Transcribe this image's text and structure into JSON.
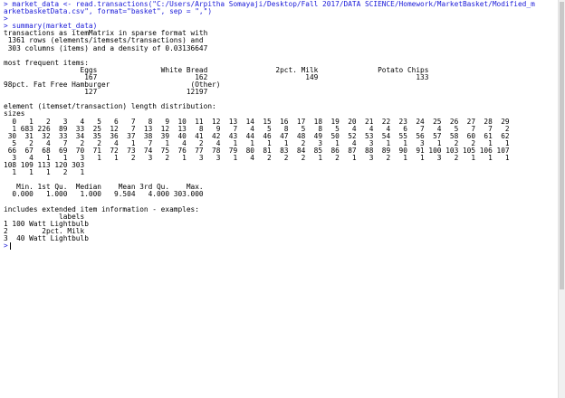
{
  "console": {
    "lines": [
      {
        "type": "cmd",
        "text": "> market_data <- read.transactions(\"C:/Users/Arpitha Somayaji/Desktop/Fall 2017/DATA SCIENCE/Homework/MarketBasket/Modified_m"
      },
      {
        "type": "cmd",
        "text": "arketbasketData.csv\", format=\"basket\", sep = \",\")"
      },
      {
        "type": "cmd",
        "text": ">"
      },
      {
        "type": "cmd",
        "text": "> summary(market_data)"
      },
      {
        "type": "out",
        "text": "transactions as itemMatrix in sparse format with"
      },
      {
        "type": "out",
        "text": " 1361 rows (elements/itemsets/transactions) and"
      },
      {
        "type": "out",
        "text": " 303 columns (items) and a density of 0.03136647"
      },
      {
        "type": "out",
        "text": ""
      },
      {
        "type": "out",
        "text": "most frequent items:"
      },
      {
        "type": "out",
        "text": "                  Eggs               White Bread                2pct. Milk              Potato Chips"
      },
      {
        "type": "out",
        "text": "                   167                       162                       149                       133"
      },
      {
        "type": "out",
        "text": "98pct. Fat Free Hamburger                   (Other)"
      },
      {
        "type": "out",
        "text": "                   127                     12197"
      },
      {
        "type": "out",
        "text": ""
      },
      {
        "type": "out",
        "text": "element (itemset/transaction) length distribution:"
      },
      {
        "type": "out",
        "text": "sizes"
      },
      {
        "type": "out",
        "text": "  0   1   2   3   4   5   6   7   8   9  10  11  12  13  14  15  16  17  18  19  20  21  22  23  24  25  26  27  28  29"
      },
      {
        "type": "out",
        "text": "  1 683 226  89  33  25  12   7  13  12  13   8   9   7   4   5   8   5   8   5   4   4   4   6   7   4   5   7   7   2"
      },
      {
        "type": "out",
        "text": " 30  31  32  33  34  35  36  37  38  39  40  41  42  43  44  46  47  48  49  50  52  53  54  55  56  57  58  60  61  62"
      },
      {
        "type": "out",
        "text": "  5   2   4   7   2   2   4   1   7   1   4   2   4   1   1   1   1   2   3   1   4   3   1   1   3   1   2   2   1   1"
      },
      {
        "type": "out",
        "text": " 66  67  68  69  70  71  72  73  74  75  76  77  78  79  80  81  83  84  85  86  87  88  89  90  91 100 103 105 106 107"
      },
      {
        "type": "out",
        "text": "  3   4   1   1   3   1   1   2   3   2   1   3   3   1   4   2   2   2   1   2   1   3   2   1   1   3   2   1   1   1"
      },
      {
        "type": "out",
        "text": "108 109 113 120 303"
      },
      {
        "type": "out",
        "text": "  1   1   1   2   1"
      },
      {
        "type": "out",
        "text": ""
      },
      {
        "type": "out",
        "text": "   Min. 1st Qu.  Median    Mean 3rd Qu.    Max."
      },
      {
        "type": "out",
        "text": "  0.000   1.000   1.000   9.504   4.000 303.000"
      },
      {
        "type": "out",
        "text": ""
      },
      {
        "type": "out",
        "text": "includes extended item information - examples:"
      },
      {
        "type": "out",
        "text": "             labels"
      },
      {
        "type": "out",
        "text": "1 100 Watt Lightbulb"
      },
      {
        "type": "out",
        "text": "2        2pct. Milk"
      },
      {
        "type": "out",
        "text": "3  40 Watt Lightbulb"
      }
    ],
    "prompt": ">"
  },
  "colors": {
    "command": "#1818d8",
    "output": "#000000",
    "background": "#ffffff"
  }
}
